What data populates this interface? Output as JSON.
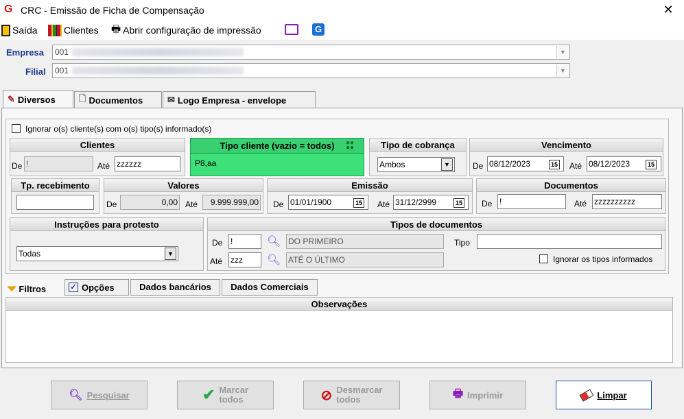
{
  "window": {
    "title": "CRC - Emissão de Ficha de Compensação",
    "close_glyph": "✕"
  },
  "toolbar": {
    "exit_label": "Saída",
    "clients_label": "Clientes",
    "print_config_label": "Abrir configuração de impressão"
  },
  "empresa": {
    "label": "Empresa",
    "code": "001"
  },
  "filial": {
    "label": "Filial",
    "code": "001"
  },
  "tabs": [
    {
      "label": "Diversos"
    },
    {
      "label": "Documentos"
    },
    {
      "label": "Logo Empresa - envelope"
    }
  ],
  "ignore_clients": {
    "label": "Ignorar o(s) cliente(s) com o(s) tipo(s) informado(s)"
  },
  "clientes": {
    "title": "Clientes",
    "de_label": "De",
    "de_value": "!",
    "ate_label": "Até",
    "ate_value": "zzzzzz"
  },
  "tipo_cliente": {
    "title": "Tipo cliente (vazio = todos)",
    "value": "P8,aa"
  },
  "tipo_cobranca": {
    "title": "Tipo de cobrança",
    "value": "Ambos"
  },
  "vencimento": {
    "title": "Vencimento",
    "de_label": "De",
    "de_value": "08/12/2023",
    "ate_label": "Até",
    "ate_value": "08/12/2023",
    "cal_glyph": "15"
  },
  "tp_recebimento": {
    "title": "Tp. recebimento",
    "value": ""
  },
  "valores": {
    "title": "Valores",
    "de_label": "De",
    "de_value": "0,00",
    "ate_label": "Até",
    "ate_value": "9.999.999,00"
  },
  "emissao": {
    "title": "Emissão",
    "de_label": "De",
    "de_value": "01/01/1900",
    "ate_label": "Até",
    "ate_value": "31/12/2999",
    "cal_glyph": "15"
  },
  "documentos": {
    "title": "Documentos",
    "de_label": "De",
    "de_value": "!",
    "ate_label": "Até",
    "ate_value": "zzzzzzzzzz"
  },
  "instrucoes": {
    "title": "Instruções para protesto",
    "value": "Todas"
  },
  "tipos_documentos": {
    "title": "Tipos de documentos",
    "de_label": "De",
    "de_value": "!",
    "de_desc": "DO PRIMEIRO",
    "ate_label": "Até",
    "ate_value": "zzz",
    "ate_desc": "ATÉ O ÚLTIMO",
    "tipo_label": "Tipo",
    "tipo_value": "",
    "ignore_label": "Ignorar os tipos informados"
  },
  "subtabs": [
    {
      "label": "Filtros"
    },
    {
      "label": "Opções"
    },
    {
      "label": "Dados bancários"
    },
    {
      "label": "Dados Comerciais"
    }
  ],
  "observacoes": {
    "title": "Observações"
  },
  "buttons": {
    "pesquisar": {
      "label": "Pesquisar"
    },
    "marcar_todos": {
      "line1": "Marcar",
      "line2": "todos"
    },
    "desmarcar_todos": {
      "line1": "Desmarcar",
      "line2": "todos"
    },
    "imprimir": {
      "label": "Imprimir"
    },
    "limpar": {
      "label": "Limpar"
    }
  },
  "colors": {
    "label_blue": "#1a3a8f",
    "highlight_green": "#3ee07a",
    "disabled_text": "#999999"
  }
}
